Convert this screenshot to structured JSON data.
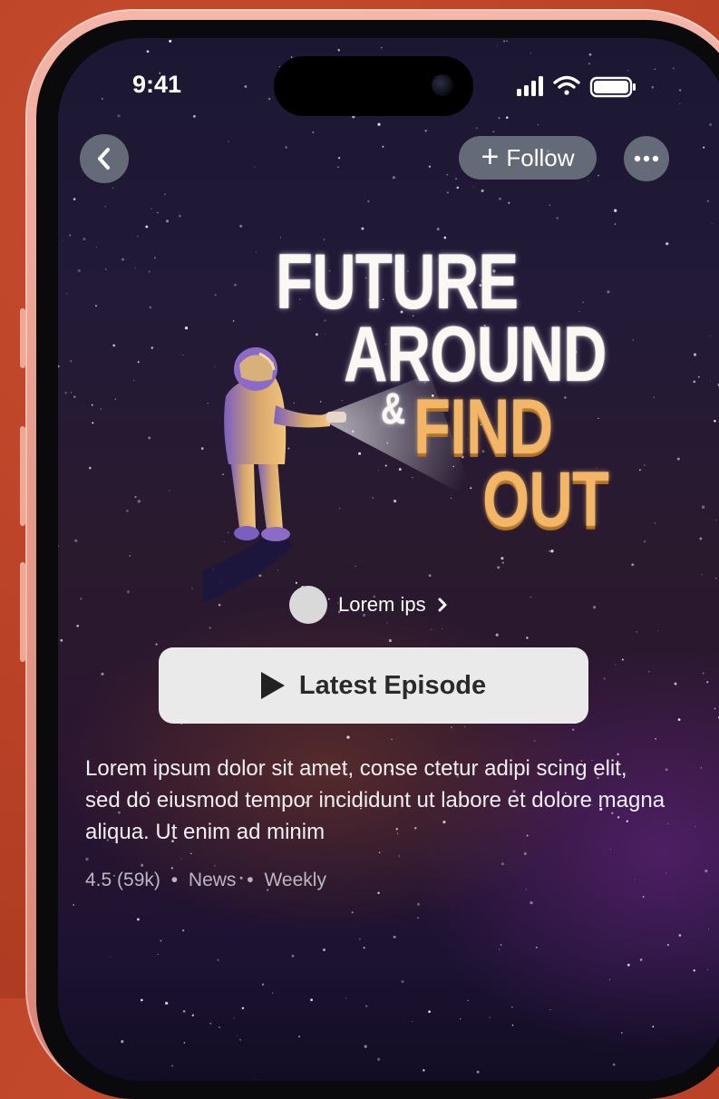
{
  "status_bar": {
    "time": "9:41"
  },
  "nav": {
    "follow_label": "Follow"
  },
  "artwork": {
    "line1": "FUTURE",
    "line2": "AROUND",
    "ampersand": "&",
    "line3": "FIND",
    "line4": "OUT"
  },
  "author": {
    "name": "Lorem ips"
  },
  "latest_episode": {
    "label": "Latest Episode"
  },
  "description": {
    "text": "Lorem ipsum dolor sit amet, conse ctetur adipi scing elit, sed do eiusmod tempor incididunt ut labore et dolore magna aliqua. Ut enim ad minim"
  },
  "meta": {
    "rating": "4.5 (59k)",
    "separator": "•",
    "category": "News",
    "frequency": "Weekly"
  },
  "colors": {
    "background": "#c1472a",
    "frame": "#e79d8c",
    "button_bg": "#eaeaea",
    "title_gold": "#f3b566",
    "title_white": "#fbf8f4"
  }
}
